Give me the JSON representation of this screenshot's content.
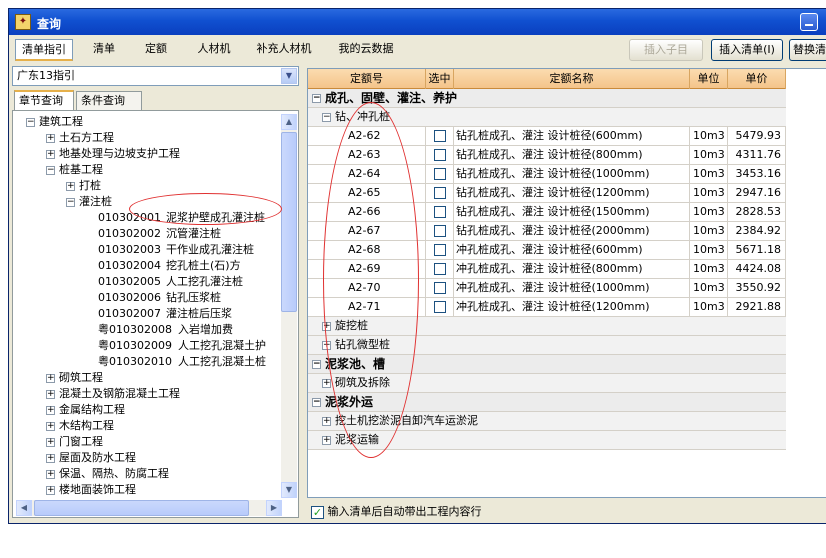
{
  "window": {
    "title": "查询"
  },
  "toolbar": {
    "tabs": [
      "清单指引",
      "清单",
      "定额",
      "人材机",
      "补充人材机",
      "我的云数据"
    ],
    "insert_child": "插入子目",
    "insert_list": "插入清单(I)",
    "replace_list": "替换清"
  },
  "left": {
    "combo_value": "广东13指引",
    "tabs": [
      "章节查询",
      "条件查询"
    ],
    "tree": [
      {
        "depth": 0,
        "expander": "−",
        "label": "建筑工程"
      },
      {
        "depth": 1,
        "expander": "+",
        "label": "土石方工程"
      },
      {
        "depth": 1,
        "expander": "+",
        "label": "地基处理与边坡支护工程"
      },
      {
        "depth": 1,
        "expander": "−",
        "label": "桩基工程"
      },
      {
        "depth": 2,
        "expander": "+",
        "label": "打桩"
      },
      {
        "depth": 2,
        "expander": "−",
        "label": "灌注桩"
      },
      {
        "depth": 3,
        "expander": "",
        "code": "010302001",
        "label": "泥浆护壁成孔灌注桩"
      },
      {
        "depth": 3,
        "expander": "",
        "code": "010302002",
        "label": "沉管灌注桩"
      },
      {
        "depth": 3,
        "expander": "",
        "code": "010302003",
        "label": "干作业成孔灌注桩"
      },
      {
        "depth": 3,
        "expander": "",
        "code": "010302004",
        "label": "挖孔桩土(石)方"
      },
      {
        "depth": 3,
        "expander": "",
        "code": "010302005",
        "label": "人工挖孔灌注桩"
      },
      {
        "depth": 3,
        "expander": "",
        "code": "010302006",
        "label": "钻孔压浆桩"
      },
      {
        "depth": 3,
        "expander": "",
        "code": "010302007",
        "label": "灌注桩后压浆"
      },
      {
        "depth": 3,
        "expander": "",
        "code": "粤010302008",
        "label": "入岩增加费"
      },
      {
        "depth": 3,
        "expander": "",
        "code": "粤010302009",
        "label": "人工挖孔混凝土护"
      },
      {
        "depth": 3,
        "expander": "",
        "code": "粤010302010",
        "label": "人工挖孔混凝土桩"
      },
      {
        "depth": 1,
        "expander": "+",
        "label": "砌筑工程"
      },
      {
        "depth": 1,
        "expander": "+",
        "label": "混凝土及钢筋混凝土工程"
      },
      {
        "depth": 1,
        "expander": "+",
        "label": "金属结构工程"
      },
      {
        "depth": 1,
        "expander": "+",
        "label": "木结构工程"
      },
      {
        "depth": 1,
        "expander": "+",
        "label": "门窗工程"
      },
      {
        "depth": 1,
        "expander": "+",
        "label": "屋面及防水工程"
      },
      {
        "depth": 1,
        "expander": "+",
        "label": "保温、隔热、防腐工程"
      },
      {
        "depth": 1,
        "expander": "+",
        "label": "楼地面装饰工程"
      }
    ]
  },
  "grid": {
    "headers": [
      "定额号",
      "选中",
      "定额名称",
      "单位",
      "单价"
    ],
    "rows": [
      {
        "kind": "group",
        "expander": "−",
        "label": "成孔、固壁、灌注、养护"
      },
      {
        "kind": "sub",
        "expander": "−",
        "label": "钻、冲孔桩"
      },
      {
        "kind": "item",
        "code": "A2-62",
        "name": "钻孔桩成孔、灌注 设计桩径(600mm)",
        "unit": "10m3",
        "price": "5479.93"
      },
      {
        "kind": "item",
        "code": "A2-63",
        "name": "钻孔桩成孔、灌注 设计桩径(800mm)",
        "unit": "10m3",
        "price": "4311.76"
      },
      {
        "kind": "item",
        "code": "A2-64",
        "name": "钻孔桩成孔、灌注 设计桩径(1000mm)",
        "unit": "10m3",
        "price": "3453.16"
      },
      {
        "kind": "item",
        "code": "A2-65",
        "name": "钻孔桩成孔、灌注 设计桩径(1200mm)",
        "unit": "10m3",
        "price": "2947.16"
      },
      {
        "kind": "item",
        "code": "A2-66",
        "name": "钻孔桩成孔、灌注 设计桩径(1500mm)",
        "unit": "10m3",
        "price": "2828.53"
      },
      {
        "kind": "item",
        "code": "A2-67",
        "name": "钻孔桩成孔、灌注 设计桩径(2000mm)",
        "unit": "10m3",
        "price": "2384.92"
      },
      {
        "kind": "item",
        "code": "A2-68",
        "name": "冲孔桩成孔、灌注 设计桩径(600mm)",
        "unit": "10m3",
        "price": "5671.18"
      },
      {
        "kind": "item",
        "code": "A2-69",
        "name": "冲孔桩成孔、灌注 设计桩径(800mm)",
        "unit": "10m3",
        "price": "4424.08"
      },
      {
        "kind": "item",
        "code": "A2-70",
        "name": "冲孔桩成孔、灌注 设计桩径(1000mm)",
        "unit": "10m3",
        "price": "3550.92"
      },
      {
        "kind": "item",
        "code": "A2-71",
        "name": "冲孔桩成孔、灌注 设计桩径(1200mm)",
        "unit": "10m3",
        "price": "2921.88"
      },
      {
        "kind": "sub",
        "expander": "+",
        "label": "旋挖桩"
      },
      {
        "kind": "sub",
        "expander": "+",
        "label": "钻孔微型桩"
      },
      {
        "kind": "group",
        "expander": "−",
        "label": "泥浆池、槽"
      },
      {
        "kind": "sub",
        "expander": "+",
        "label": "砌筑及拆除"
      },
      {
        "kind": "group",
        "expander": "−",
        "label": "泥浆外运"
      },
      {
        "kind": "sub",
        "expander": "+",
        "label": "挖土机挖淤泥自卸汽车运淤泥"
      },
      {
        "kind": "sub",
        "expander": "+",
        "label": "泥浆运输"
      }
    ]
  },
  "footer": {
    "auto_option": "输入清单后自动带出工程内容行",
    "checked": true
  },
  "colors": {
    "title_bar": "#0a3fbf",
    "header": "#f4c48a",
    "annotation": "#e03030"
  }
}
